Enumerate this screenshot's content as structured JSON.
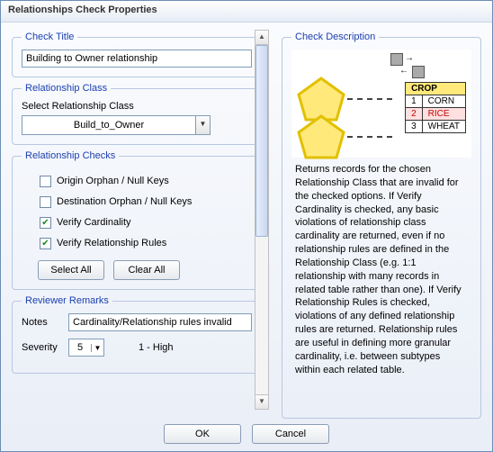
{
  "window": {
    "title": "Relationships Check Properties"
  },
  "checkTitle": {
    "legend": "Check Title",
    "value": "Building to Owner relationship"
  },
  "relClass": {
    "legend": "Relationship Class",
    "label": "Select Relationship Class",
    "selected": "Build_to_Owner"
  },
  "relChecks": {
    "legend": "Relationship Checks",
    "items": [
      {
        "label": "Origin Orphan / Null Keys",
        "checked": false
      },
      {
        "label": "Destination Orphan / Null Keys",
        "checked": false
      },
      {
        "label": "Verify Cardinality",
        "checked": true
      },
      {
        "label": "Verify Relationship Rules",
        "checked": true
      }
    ],
    "selectAll": "Select All",
    "clearAll": "Clear All"
  },
  "remarks": {
    "legend": "Reviewer Remarks",
    "notesLabel": "Notes",
    "notesValue": "Cardinality/Relationship rules invalid",
    "severityLabel": "Severity",
    "severityValue": "5",
    "severityLegend": "1 - High"
  },
  "description": {
    "legend": "Check Description",
    "diagram": {
      "table_header": "CROP",
      "rows": [
        {
          "n": "1",
          "v": "CORN"
        },
        {
          "n": "2",
          "v": "RICE"
        },
        {
          "n": "3",
          "v": "WHEAT"
        }
      ],
      "selected_row": 1
    },
    "text": "Returns records for the chosen Relationship Class that are invalid for the checked options.   If Verify Cardinality is checked, any basic violations of relationship class cardinality are returned, even if no relationship rules are defined in the Relationship Class (e.g. 1:1 relationship with many records in related table rather than one).  If Verify Relationship Rules is checked, violations of any defined relationship rules are returned.  Relationship rules are useful in defining more granular cardinality, i.e. between subtypes within each related table."
  },
  "footer": {
    "ok": "OK",
    "cancel": "Cancel"
  }
}
